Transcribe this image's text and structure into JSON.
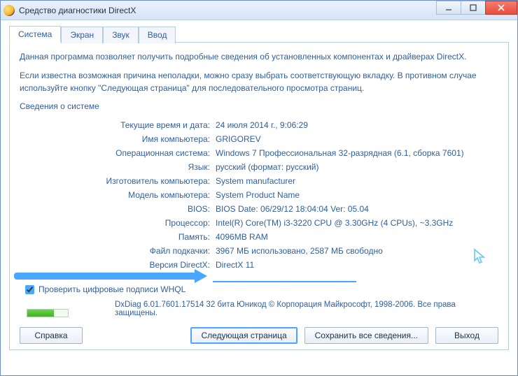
{
  "window": {
    "title": "Средство диагностики DirectX"
  },
  "tabs": {
    "system": "Система",
    "display": "Экран",
    "sound": "Звук",
    "input": "Ввод"
  },
  "intro": {
    "p1": "Данная программа позволяет получить подробные сведения об установленных компонентах и драйверах DirectX.",
    "p2": "Если известна возможная причина неполадки, можно сразу выбрать соответствующую вкладку. В противном случае используйте кнопку \"Следующая страница\" для последовательного просмотра страниц."
  },
  "section": {
    "title": "Сведения о системе"
  },
  "info": {
    "datetime_label": "Текущие время и дата:",
    "datetime_value": "24 июля 2014 г., 9:06:29",
    "computer_label": "Имя компьютера:",
    "computer_value": "GRIGOREV",
    "os_label": "Операционная система:",
    "os_value": "Windows 7 Профессиональная 32-разрядная (6.1, сборка 7601)",
    "lang_label": "Язык:",
    "lang_value": "русский (формат: русский)",
    "manuf_label": "Изготовитель компьютера:",
    "manuf_value": "System manufacturer",
    "model_label": "Модель компьютера:",
    "model_value": "System Product Name",
    "bios_label": "BIOS:",
    "bios_value": "BIOS Date: 06/29/12 18:04:04 Ver: 05.04",
    "cpu_label": "Процессор:",
    "cpu_value": "Intel(R) Core(TM) i3-3220 CPU @ 3.30GHz (4 CPUs), ~3.3GHz",
    "mem_label": "Память:",
    "mem_value": "4096MB RAM",
    "page_label": "Файл подкачки:",
    "page_value": "3967 МБ использовано, 2587 МБ свободно",
    "dx_label": "Версия DirectX:",
    "dx_value": "DirectX 11"
  },
  "whql": {
    "label": "Проверить цифровые подписи WHQL"
  },
  "footer": {
    "text": "DxDiag 6.01.7601.17514 32 бита Юникод   © Корпорация Майкрософт, 1998-2006.  Все права защищены."
  },
  "buttons": {
    "help": "Справка",
    "next": "Следующая страница",
    "save": "Сохранить все сведения...",
    "exit": "Выход"
  }
}
